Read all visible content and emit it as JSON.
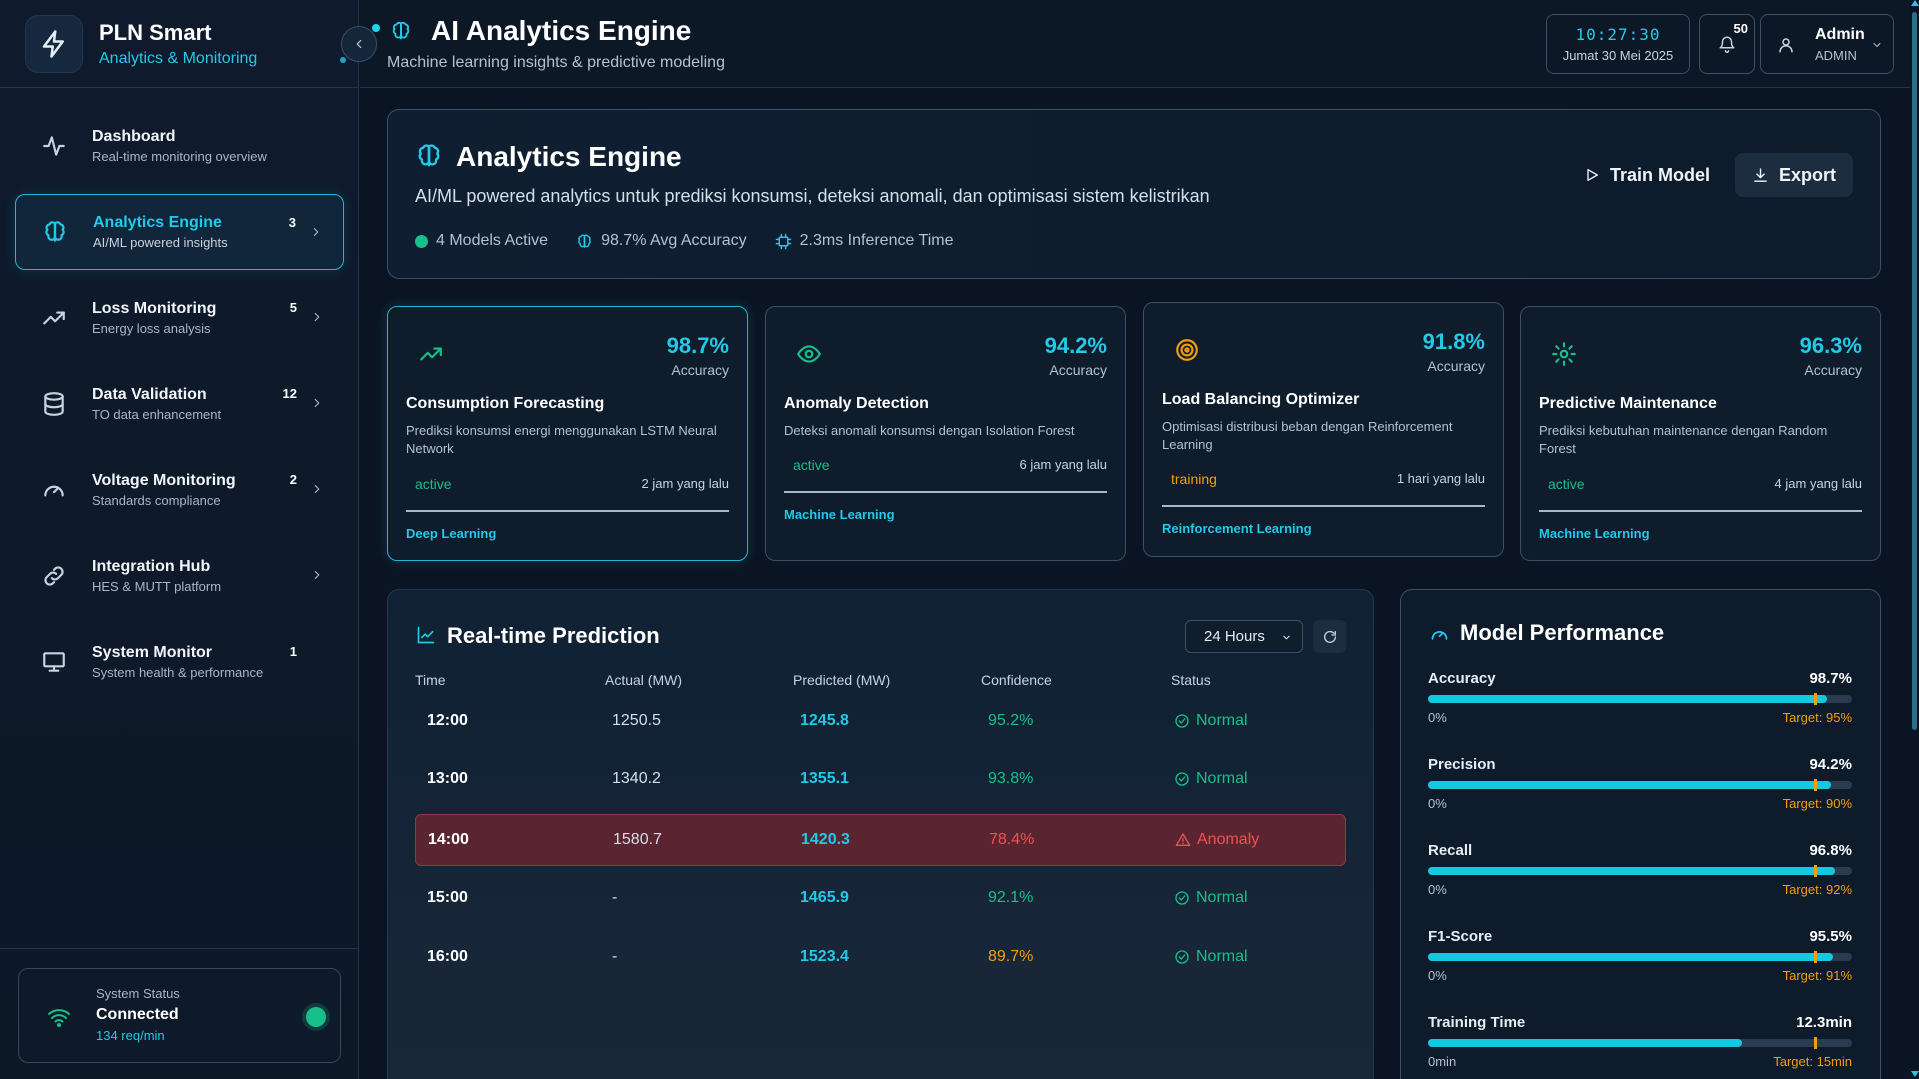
{
  "brand": {
    "title": "PLN Smart",
    "subtitle": "Analytics & Monitoring"
  },
  "sidebar": {
    "items": [
      {
        "label": "Dashboard",
        "desc": "Real-time monitoring overview",
        "badge": "",
        "icon": "activity-icon"
      },
      {
        "label": "Analytics Engine",
        "desc": "AI/ML powered insights",
        "badge": "3",
        "icon": "brain-icon"
      },
      {
        "label": "Loss Monitoring",
        "desc": "Energy loss analysis",
        "badge": "5",
        "icon": "trending-up-icon"
      },
      {
        "label": "Data Validation",
        "desc": "TO data enhancement",
        "badge": "12",
        "icon": "database-icon"
      },
      {
        "label": "Voltage Monitoring",
        "desc": "Standards compliance",
        "badge": "2",
        "icon": "gauge-icon"
      },
      {
        "label": "Integration Hub",
        "desc": "HES & MUTT platform",
        "badge": "",
        "icon": "link-icon"
      },
      {
        "label": "System Monitor",
        "desc": "System health & performance",
        "badge": "1",
        "icon": "monitor-icon"
      }
    ],
    "status": {
      "label": "System Status",
      "value": "Connected",
      "rate": "134 req/min"
    }
  },
  "header": {
    "title": "AI Analytics Engine",
    "subtitle": "Machine learning insights & predictive modeling",
    "time": "10:27:30",
    "date": "Jumat 30 Mei 2025",
    "notifications": "50",
    "user_name": "Admin",
    "user_role": "ADMIN"
  },
  "banner": {
    "title": "Analytics Engine",
    "description": "AI/ML powered analytics untuk prediksi konsumsi, deteksi anomali, dan optimisasi sistem kelistrikan",
    "models_active": "4 Models Active",
    "avg_accuracy": "98.7% Avg Accuracy",
    "inference": "2.3ms Inference Time",
    "train_label": "Train Model",
    "export_label": "Export"
  },
  "models": [
    {
      "accuracy": "98.7%",
      "accuracy_label": "Accuracy",
      "title": "Consumption Forecasting",
      "desc": "Prediksi konsumsi energi menggunakan LSTM Neural Network",
      "status": "active",
      "when": "2 jam yang lalu",
      "tag": "Deep Learning",
      "icon": "trending-up-icon"
    },
    {
      "accuracy": "94.2%",
      "accuracy_label": "Accuracy",
      "title": "Anomaly Detection",
      "desc": "Deteksi anomali konsumsi dengan Isolation Forest",
      "status": "active",
      "when": "6 jam yang lalu",
      "tag": "Machine Learning",
      "icon": "eye-icon"
    },
    {
      "accuracy": "91.8%",
      "accuracy_label": "Accuracy",
      "title": "Load Balancing Optimizer",
      "desc": "Optimisasi distribusi beban dengan Reinforcement Learning",
      "status": "training",
      "when": "1 hari yang lalu",
      "tag": "Reinforcement Learning",
      "icon": "target-icon"
    },
    {
      "accuracy": "96.3%",
      "accuracy_label": "Accuracy",
      "title": "Predictive Maintenance",
      "desc": "Prediksi kebutuhan maintenance dengan Random Forest",
      "status": "active",
      "when": "4 jam yang lalu",
      "tag": "Machine Learning",
      "icon": "gear-icon"
    }
  ],
  "prediction": {
    "title": "Real-time Prediction",
    "range": "24 Hours",
    "columns": [
      "Time",
      "Actual (MW)",
      "Predicted (MW)",
      "Confidence",
      "Status"
    ],
    "rows": [
      {
        "time": "12:00",
        "actual": "1250.5",
        "predicted": "1245.8",
        "confidence": "95.2%",
        "status": "Normal",
        "confidence_color": "#17c08a"
      },
      {
        "time": "13:00",
        "actual": "1340.2",
        "predicted": "1355.1",
        "confidence": "93.8%",
        "status": "Normal",
        "confidence_color": "#17c08a"
      },
      {
        "time": "14:00",
        "actual": "1580.7",
        "predicted": "1420.3",
        "confidence": "78.4%",
        "status": "Anomaly",
        "confidence_color": "#f05252"
      },
      {
        "time": "15:00",
        "actual": "-",
        "predicted": "1465.9",
        "confidence": "92.1%",
        "status": "Normal",
        "confidence_color": "#17c08a"
      },
      {
        "time": "16:00",
        "actual": "-",
        "predicted": "1523.4",
        "confidence": "89.7%",
        "status": "Normal",
        "confidence_color": "#f59e0b"
      }
    ]
  },
  "performance": {
    "title": "Model Performance",
    "metrics": [
      {
        "name": "Accuracy",
        "value": "98.7%",
        "min": "0%",
        "target": "Target: 95%",
        "fill": 0.94,
        "target_pos": 0.91
      },
      {
        "name": "Precision",
        "value": "94.2%",
        "min": "0%",
        "target": "Target: 90%",
        "fill": 0.95,
        "target_pos": 0.91
      },
      {
        "name": "Recall",
        "value": "96.8%",
        "min": "0%",
        "target": "Target: 92%",
        "fill": 0.96,
        "target_pos": 0.91
      },
      {
        "name": "F1-Score",
        "value": "95.5%",
        "min": "0%",
        "target": "Target: 91%",
        "fill": 0.955,
        "target_pos": 0.91
      },
      {
        "name": "Training Time",
        "value": "12.3min",
        "min": "0min",
        "target": "Target: 15min",
        "fill": 0.74,
        "target_pos": 0.91
      }
    ]
  },
  "colors": {
    "accent": "#22c9e8",
    "success": "#17c08a",
    "warning": "#f59e0b",
    "danger": "#f05252"
  }
}
